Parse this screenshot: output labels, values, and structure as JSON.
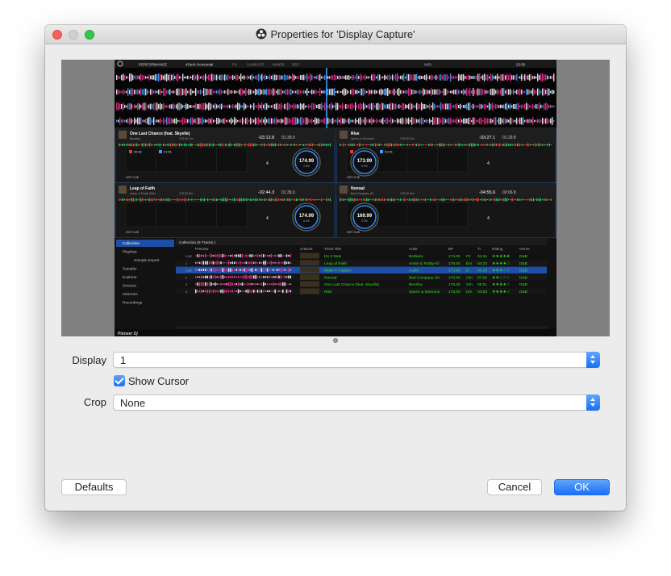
{
  "window": {
    "title": "Properties for 'Display Capture'"
  },
  "capture": {
    "toolbar": {
      "mode": "PERFORMANCE",
      "layout": "4Deck Horizontal",
      "fx": "FX",
      "sampler": "SAMPLER",
      "mixer": "MIXER",
      "rec": "REC",
      "midi": "MIDI",
      "clock": "23:50"
    },
    "decks": [
      {
        "title": "One Last Chance (feat. Skyelle)",
        "artist": "Bensley",
        "bpm_key": "175.00 Gm",
        "remain": "-03:13.8",
        "elapsed": "01:39.0",
        "jog_bpm": "174.99",
        "jog_pct": "0.0%",
        "hot_a": "00:08",
        "hot_b": "01:06",
        "hot_cue": "HOT CUE",
        "deck_no": "4"
      },
      {
        "title": "Rise",
        "artist": "Aperio & Monrace",
        "bpm_key": "175.00 Dm",
        "remain": "-03:27.1",
        "elapsed": "01:29.8",
        "jog_bpm": "173.99",
        "jog_pct": "0.0%",
        "hot_a": "00:08",
        "hot_b": "01:06",
        "hot_cue": "HOT CUE",
        "deck_no": "4"
      },
      {
        "title": "Leap of Faith",
        "artist": "Annie & Teddy Killer",
        "bpm_key": "175.00 Em",
        "remain": "-02:44.3",
        "elapsed": "01:39.3",
        "jog_bpm": "174.99",
        "jog_pct": "0.0%",
        "hot_cue": "HOT CUE",
        "deck_no": "4"
      },
      {
        "title": "Nomad",
        "artist": "Bad Company UK",
        "bpm_key": "175.00 Gm",
        "remain": "-04:55.6",
        "elapsed": "02:06.8",
        "jog_bpm": "169.99",
        "jog_pct": "0.0%",
        "hot_cue": "HOT CUE",
        "deck_no": "4"
      }
    ],
    "browser": {
      "tree": [
        "Collection",
        "Playlists",
        "Sample Export",
        "Sampler",
        "Explorer",
        "Devices",
        "Histories",
        "Recordings"
      ],
      "header": "Collection (6 Tracks )",
      "columns": [
        "Preview",
        "Artwork",
        "Track Title",
        "Artist",
        "BP",
        "Ti",
        "Rating",
        "Genre"
      ],
      "rows": [
        {
          "cue": "CUE",
          "title": "Do It Now",
          "artist": "Barbarix",
          "bpm": "174.00",
          "key": "F#",
          "time": "04:31",
          "rating": "★★★★★",
          "genre": "D&B"
        },
        {
          "cue": "1",
          "title": "Leap of Faith",
          "artist": "Annie & Teddy Kil",
          "bpm": "175.00",
          "key": "Em",
          "time": "04:23",
          "rating": "★★★★☆",
          "genre": "D&B"
        },
        {
          "cue": "CUE",
          "title": "Make It Happen",
          "artist": "Audio",
          "bpm": "173.98",
          "key": "D",
          "time": "04:26",
          "rating": "★★★☆☆",
          "genre": "D&B"
        },
        {
          "cue": "2",
          "title": "Nomad",
          "artist": "Bad Company UK",
          "bpm": "175.00",
          "key": "Gm",
          "time": "07:02",
          "rating": "★★☆☆☆",
          "genre": "D&B"
        },
        {
          "cue": "3",
          "title": "One Last Chance (feat. Skyelle)",
          "artist": "Bensley",
          "bpm": "175.00",
          "key": "Gm",
          "time": "05:51",
          "rating": "★★★★☆",
          "genre": "D&B"
        },
        {
          "cue": "4",
          "title": "Rise",
          "artist": "Aperio & Monrace",
          "bpm": "175.00",
          "key": "Dm",
          "time": "04:50",
          "rating": "★★★★☆",
          "genre": "D&B"
        }
      ],
      "logo": "Pioneer Dj"
    }
  },
  "form": {
    "display_label": "Display",
    "display_value": "1",
    "show_cursor_label": "Show Cursor",
    "show_cursor_checked": true,
    "crop_label": "Crop",
    "crop_value": "None"
  },
  "buttons": {
    "defaults": "Defaults",
    "cancel": "Cancel",
    "ok": "OK"
  },
  "colors": {
    "accent": "#1a6ff5",
    "waveform_pink": "#e0308a",
    "waveform_blue": "#3aa0ff",
    "browser_text": "#33e51b",
    "selection": "#1e4fa8"
  }
}
